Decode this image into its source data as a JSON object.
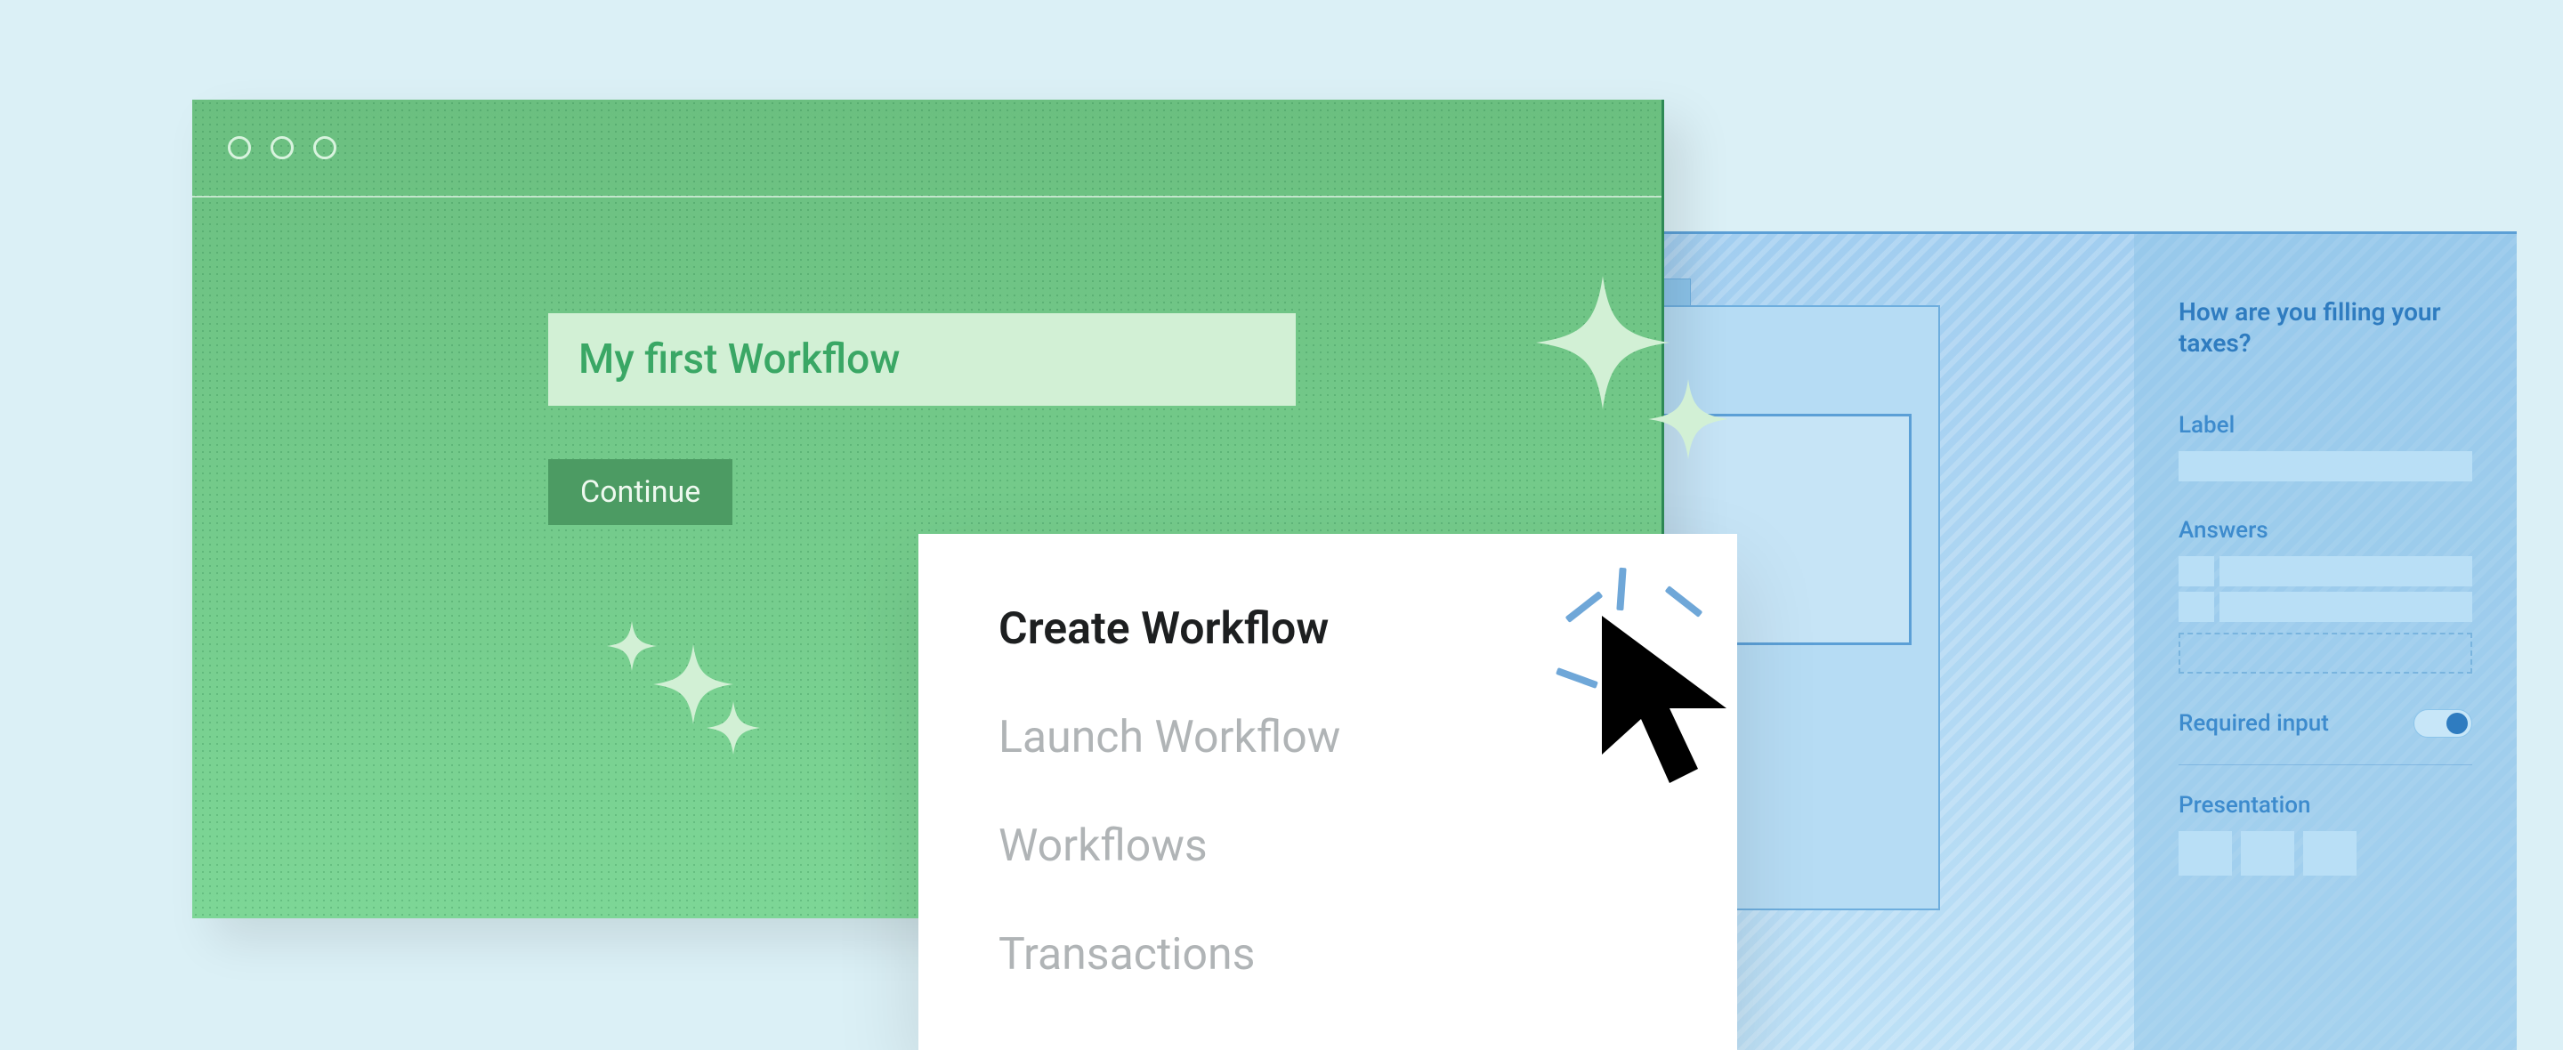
{
  "green": {
    "title_value": "My first Workflow",
    "continue_label": "Continue"
  },
  "menu": {
    "items": [
      "Create  Workflow",
      "Launch Workflow",
      "Workflows",
      "Transactions"
    ]
  },
  "blue": {
    "heading": "How are you filling your taxes?",
    "label_label": "Label",
    "answers_label": "Answers",
    "required_label": "Required input",
    "presentation_label": "Presentation"
  }
}
